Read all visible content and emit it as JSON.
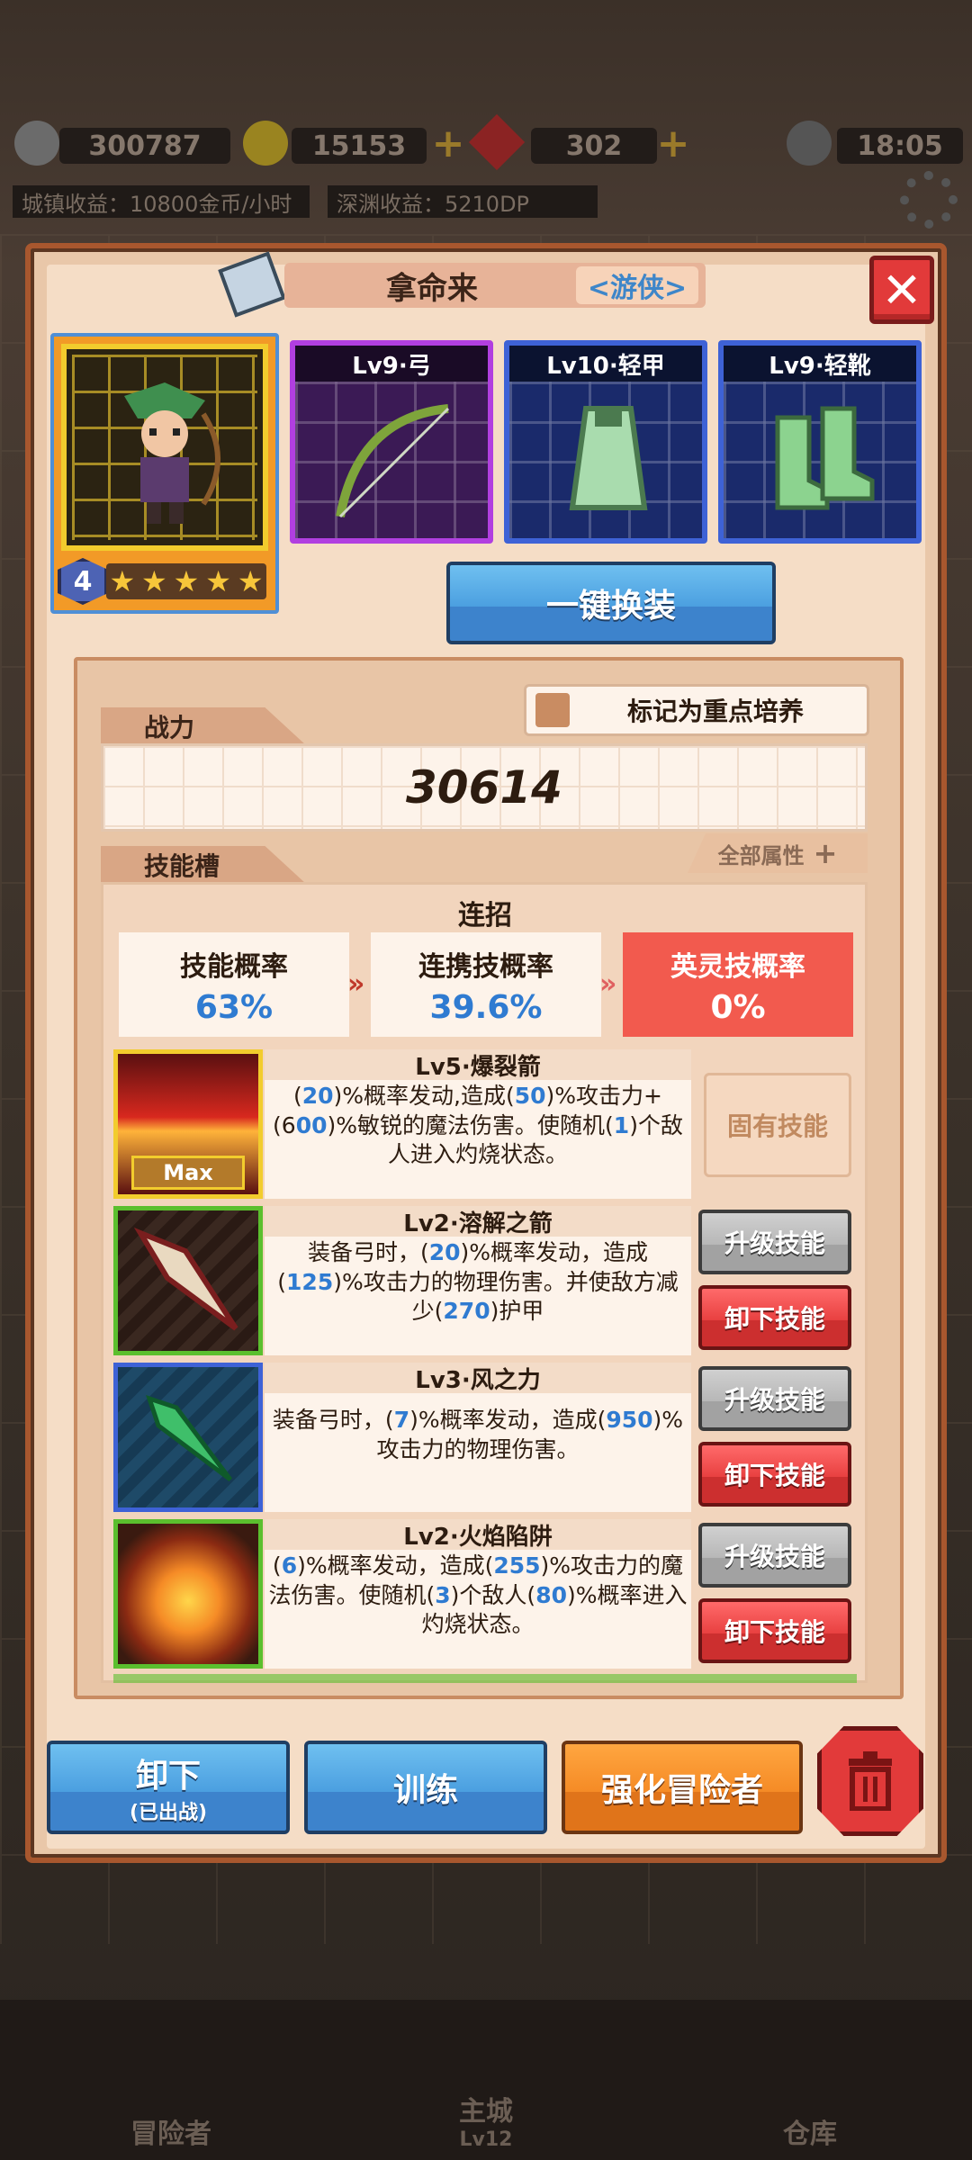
{
  "hud": {
    "power_total": "300787",
    "gold": "15153",
    "gems": "302",
    "time": "18:05",
    "town_income": "城镇收益：10800金币/小时",
    "abyss_income": "深渊收益：5210DP"
  },
  "dialog": {
    "hero_name": "拿命来",
    "hero_class": "<游侠>",
    "close_symbol": "✕",
    "hero_level": "4",
    "stars": [
      "★",
      "★",
      "★",
      "★",
      "★"
    ]
  },
  "equipment": [
    {
      "label": "Lv9·弓",
      "icon": "bow-icon",
      "color": "#b13fe0"
    },
    {
      "label": "Lv10·轻甲",
      "icon": "light-armor-icon",
      "color": "#3e62d6"
    },
    {
      "label": "Lv9·轻靴",
      "icon": "light-boots-icon",
      "color": "#3e62d6"
    }
  ],
  "quick_equip_label": "一键换装",
  "mark_focus_label": "标记为重点培养",
  "power": {
    "tab": "战力",
    "value": "30614"
  },
  "all_attrs_label": "全部属性",
  "skill_slot_tab": "技能槽",
  "combo": {
    "title": "连招",
    "skill_prob": {
      "label": "技能概率",
      "value": "63%"
    },
    "combo_prob": {
      "label": "连携技概率",
      "value": "39.6%"
    },
    "spirit_prob": {
      "label": "英灵技概率",
      "value": "0%"
    }
  },
  "skills": [
    {
      "name": "Lv5·爆裂箭",
      "desc": [
        "(",
        "20",
        ")%概率发动,造成(",
        "50",
        ")%攻击力+(6",
        "00",
        ")%敏锐的魔法伤害。使随机(",
        "1",
        ")个敌人进入灼烧状态。"
      ],
      "badge": "Max",
      "fixed_label": "固有技能",
      "border": "#f2cc2d"
    },
    {
      "name": "Lv2·溶解之箭",
      "desc": [
        "装备弓时，(",
        "20",
        ")%概率发动，造成(",
        "125",
        ")%攻击力的物理伤害。并使敌方减少(",
        "270",
        ")护甲"
      ],
      "upgrade_label": "升级技能",
      "remove_label": "卸下技能",
      "border": "#5bbf2e"
    },
    {
      "name": "Lv3·风之力",
      "desc": [
        "装备弓时，(",
        "7",
        ")%概率发动，造成(",
        "950",
        ")%攻击力的物理伤害。"
      ],
      "upgrade_label": "升级技能",
      "remove_label": "卸下技能",
      "border": "#3e62d6"
    },
    {
      "name": "Lv2·火焰陷阱",
      "desc": [
        "(",
        "6",
        ")%概率发动，造成(",
        "255",
        ")%攻击力的魔法伤害。使随机(",
        "3",
        ")个敌人(",
        "80",
        ")%概率进入灼烧状态。"
      ],
      "upgrade_label": "升级技能",
      "remove_label": "卸下技能",
      "border": "#5bbf2e"
    }
  ],
  "bottom_buttons": {
    "unequip": "卸下",
    "unequip_sub": "(已出战)",
    "train": "训练",
    "enhance": "强化冒险者"
  },
  "bottom_nav": [
    {
      "label": "冒险者"
    },
    {
      "label": "主城",
      "sub": "Lv12"
    },
    {
      "label": "仓库"
    }
  ],
  "colors": {
    "accent_blue": "#2f7bd1",
    "danger_red": "#e84040",
    "panel": "#f5ddc6"
  }
}
